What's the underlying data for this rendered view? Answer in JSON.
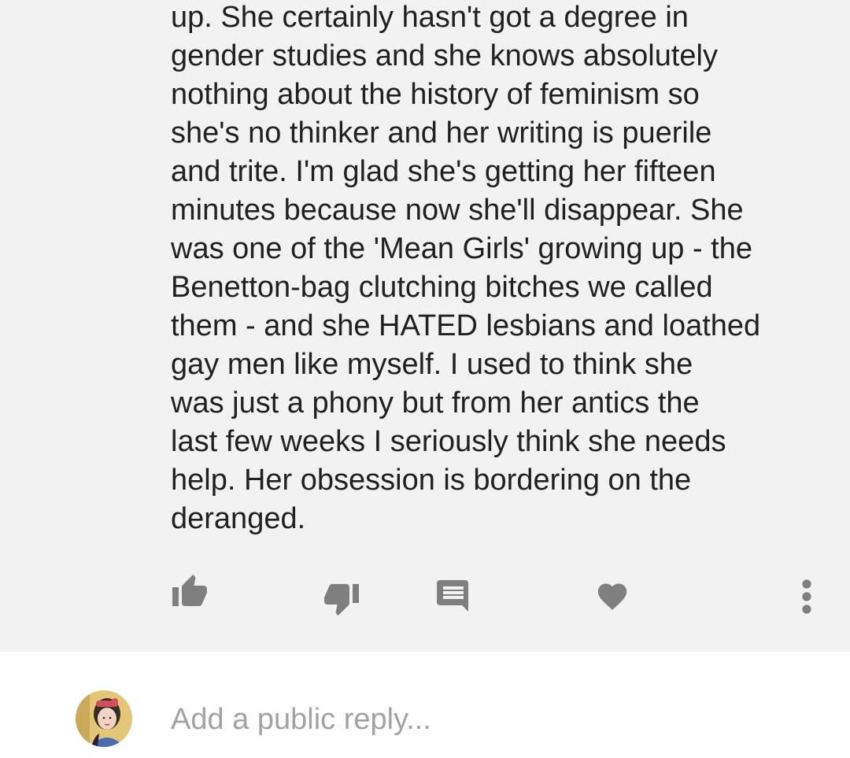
{
  "comment": {
    "lines": [
      "up.  She certainly hasn't got a degree in",
      "gender studies and she knows absolutely",
      "nothing about the history of feminism so",
      "she's no thinker and her writing is puerile",
      "and trite.  I'm glad she's getting her fifteen",
      "minutes because now she'll disappear.  She",
      "was one of the 'Mean Girls' growing up - the",
      "Benetton-bag clutching bitches we called",
      "them - and she HATED lesbians and loathed",
      "gay men like myself.  I used to think she",
      "was just a phony but from her antics the",
      "last few weeks I seriously think she needs",
      "help.  Her obsession is bordering on the",
      "deranged."
    ]
  },
  "actions": {
    "like_icon": "thumbs-up-icon",
    "dislike_icon": "thumbs-down-icon",
    "reply_icon": "comment-icon",
    "heart_icon": "heart-icon",
    "more_icon": "more-vertical-icon"
  },
  "reply": {
    "placeholder": "Add a public reply..."
  },
  "colors": {
    "comment_background": "#f2f2f2",
    "icon": "#7f7f7f",
    "text": "#212121",
    "placeholder": "#a3a3a3"
  }
}
